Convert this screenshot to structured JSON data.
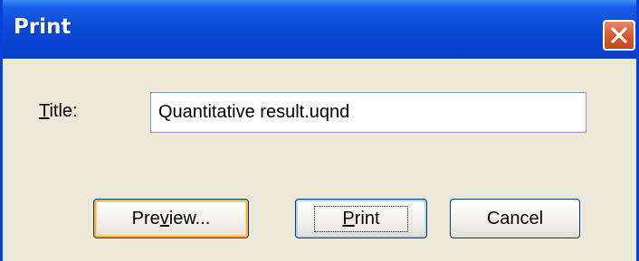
{
  "window": {
    "title": "Print"
  },
  "form": {
    "title_label_prefix": "",
    "title_label_mnemonic": "T",
    "title_label_rest": "itle:",
    "title_value": "Quantitative result.uqnd"
  },
  "buttons": {
    "preview": {
      "before": "Pre",
      "mnemonic": "v",
      "after": "iew..."
    },
    "print": {
      "before": "",
      "mnemonic": "P",
      "after": "rint"
    },
    "cancel": {
      "label": "Cancel"
    }
  },
  "colors": {
    "titlebar": "#0a4bd8",
    "dialog_bg": "#ece9d8",
    "close_button": "#d65a32",
    "hover_outline": "#f8b33c"
  },
  "icons": {
    "close": "close-icon"
  }
}
